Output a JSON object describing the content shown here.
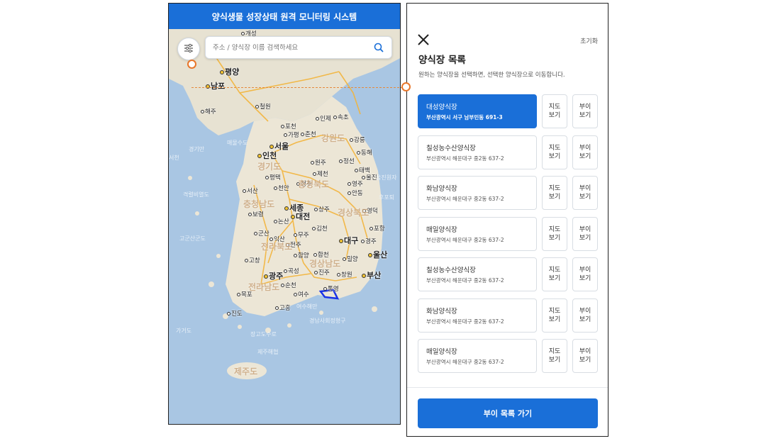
{
  "map_screen": {
    "header_title": "양식생물 성장상태 원격 모니터링 시스템",
    "search_placeholder": "주소 / 양식장 이름 검색하세요",
    "menu_icon": "filter-sliders-icon",
    "search_icon": "magnifier-icon",
    "cities": [
      {
        "name": "평양",
        "big": true
      },
      {
        "name": "남포",
        "big": true
      },
      {
        "name": "서울",
        "big": true
      },
      {
        "name": "인천",
        "big": true
      },
      {
        "name": "세종",
        "big": true
      },
      {
        "name": "대전",
        "big": true
      },
      {
        "name": "대구",
        "big": true
      },
      {
        "name": "울산",
        "big": true
      },
      {
        "name": "광주",
        "big": true
      },
      {
        "name": "부산",
        "big": true
      },
      {
        "name": "춘천",
        "big": false
      },
      {
        "name": "강릉",
        "big": false
      },
      {
        "name": "원주",
        "big": false
      },
      {
        "name": "청주",
        "big": false
      },
      {
        "name": "천안",
        "big": false
      },
      {
        "name": "전주",
        "big": false
      },
      {
        "name": "포항",
        "big": false
      },
      {
        "name": "창원",
        "big": false
      },
      {
        "name": "목포",
        "big": false
      },
      {
        "name": "여수",
        "big": false
      },
      {
        "name": "순천",
        "big": false
      },
      {
        "name": "진주",
        "big": false
      },
      {
        "name": "안동",
        "big": false
      },
      {
        "name": "김천",
        "big": false
      },
      {
        "name": "상주",
        "big": false
      },
      {
        "name": "군산",
        "big": false
      },
      {
        "name": "익산",
        "big": false
      },
      {
        "name": "논산",
        "big": false
      },
      {
        "name": "서산",
        "big": false
      },
      {
        "name": "보령",
        "big": false
      },
      {
        "name": "평택",
        "big": false
      },
      {
        "name": "속초",
        "big": false
      },
      {
        "name": "동해",
        "big": false
      },
      {
        "name": "태백",
        "big": false
      },
      {
        "name": "영주",
        "big": false
      },
      {
        "name": "제천",
        "big": false
      },
      {
        "name": "경주",
        "big": false
      },
      {
        "name": "밀양",
        "big": false
      },
      {
        "name": "포천",
        "big": false
      },
      {
        "name": "가평",
        "big": false
      },
      {
        "name": "무주",
        "big": false
      },
      {
        "name": "함양",
        "big": false
      },
      {
        "name": "합천",
        "big": false
      },
      {
        "name": "곡성",
        "big": false
      },
      {
        "name": "고창",
        "big": false
      },
      {
        "name": "진도",
        "big": false
      },
      {
        "name": "고흥",
        "big": false
      },
      {
        "name": "인제",
        "big": false
      },
      {
        "name": "철원",
        "big": false
      },
      {
        "name": "울진",
        "big": false
      },
      {
        "name": "영덕",
        "big": false
      },
      {
        "name": "정선",
        "big": false
      },
      {
        "name": "해주",
        "big": false
      },
      {
        "name": "통영",
        "big": false
      },
      {
        "name": "개성",
        "big": false
      }
    ],
    "regions": [
      "강원도",
      "경기도",
      "충청북도",
      "충청남도",
      "경상북도",
      "전라북도",
      "경상남도",
      "전라남도",
      "제주도"
    ],
    "sea_labels": [
      "경기만",
      "격렬비열도",
      "고군산군도",
      "가거도",
      "장고도수로",
      "제주해협",
      "경남사회정형구",
      "여수해만",
      "울진원자",
      "후포퇴",
      "서천",
      "매물수도"
    ]
  },
  "list_screen": {
    "reset_label": "초기화",
    "title": "양식장 목록",
    "description": "원하는 양식장을 선택하면, 선택한 양식장으로 이동합니다.",
    "map_button_label": "지도\n보기",
    "buoy_button_label": "부이\n보기",
    "farms": [
      {
        "name": "대성양식장",
        "address": "부산광역시 서구 남부민동 691-3",
        "selected": true
      },
      {
        "name": "칠성농수산양식장",
        "address": "부산광역시 해운대구 중2동 637-2",
        "selected": false
      },
      {
        "name": "화남양식장",
        "address": "부산광역시 해운대구 중2동 637-2",
        "selected": false
      },
      {
        "name": "매일양식장",
        "address": "부산광역시 해운대구 중2동 637-2",
        "selected": false
      },
      {
        "name": "칠성농수산양식장",
        "address": "부산광역시 해운대구 중2동 637-2",
        "selected": false
      },
      {
        "name": "화남양식장",
        "address": "부산광역시 해운대구 중2동 637-2",
        "selected": false
      },
      {
        "name": "매일양식장",
        "address": "부산광역시 해운대구 중2동 637-2",
        "selected": false
      }
    ],
    "bottom_button_label": "부이 목록 가기"
  },
  "colors": {
    "primary": "#1a6fd8",
    "marker": "#e8772b",
    "sea": "#a9c6e3",
    "land": "#ece6d6"
  }
}
